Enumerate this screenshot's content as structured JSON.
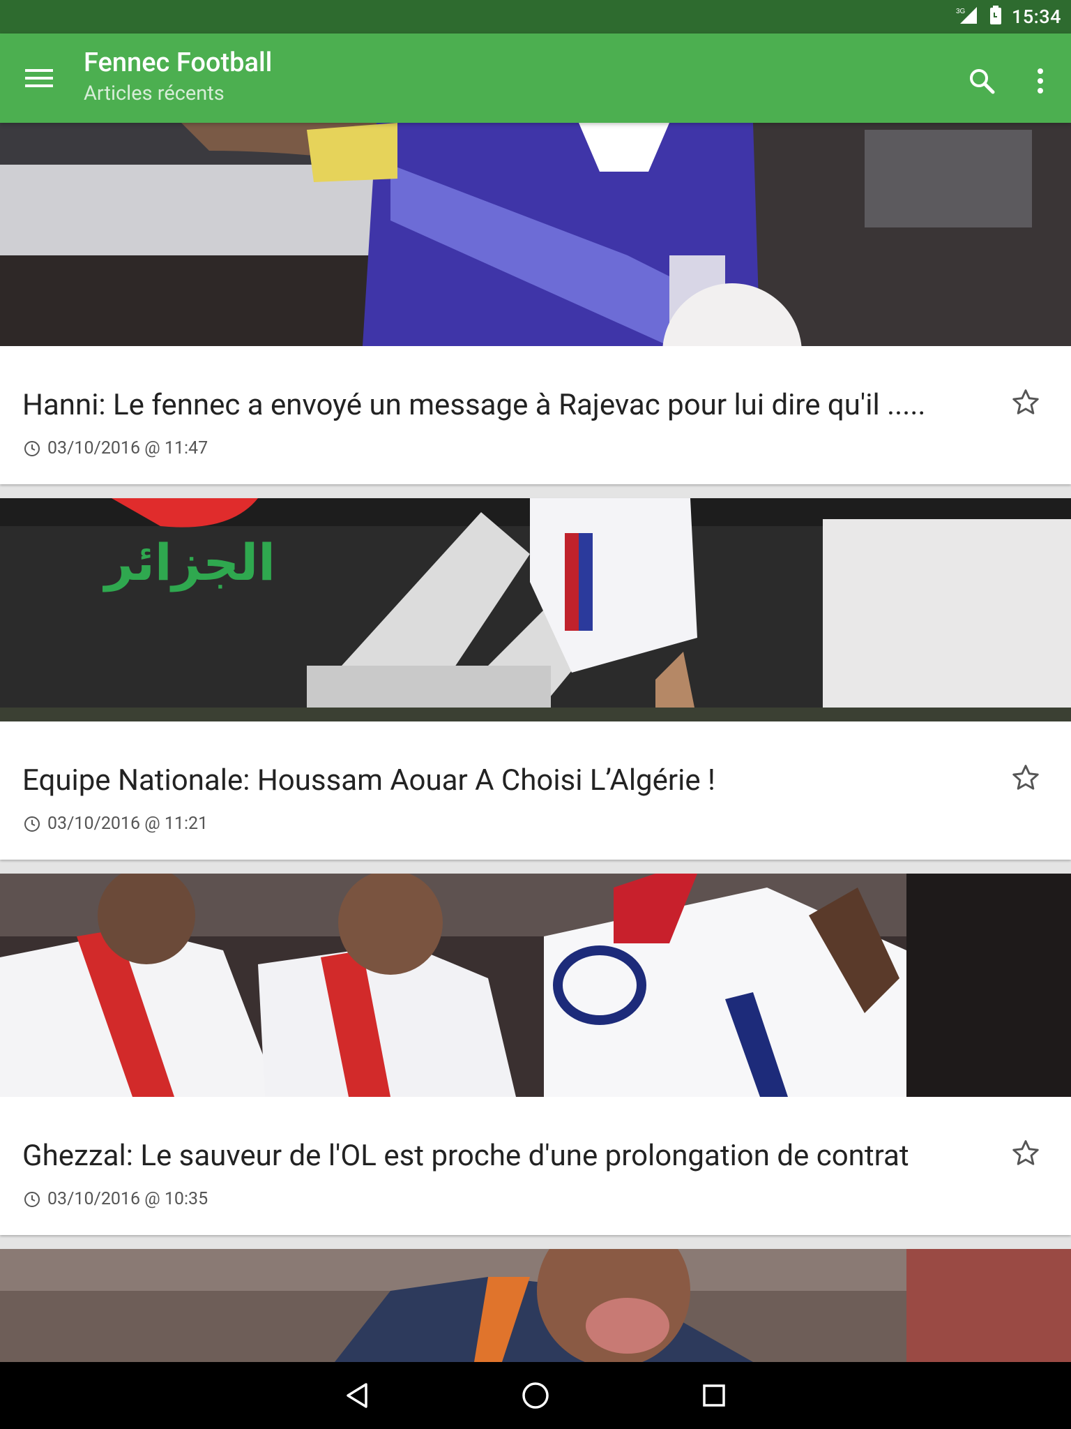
{
  "status_bar": {
    "network": "3G",
    "time": "15:34"
  },
  "app_bar": {
    "title": "Fennec Football",
    "subtitle": "Articles récents",
    "menu_icon": "hamburger-menu-icon",
    "search_icon": "search-icon",
    "overflow_icon": "more-vert-icon"
  },
  "articles": [
    {
      "title": "Hanni: Le fennec a envoyé un message à Rajevac pour lui dire qu'il .....",
      "date": "03/10/2016 @ 11:47",
      "favorited": false
    },
    {
      "title": "Equipe Nationale: Houssam Aouar A Choisi L’Algérie !",
      "date": "03/10/2016 @ 11:21",
      "favorited": false,
      "image_text": "الجزائر"
    },
    {
      "title": "Ghezzal: Le sauveur de l'OL est proche d'une prolongation de contrat",
      "date": "03/10/2016 @ 10:35",
      "favorited": false
    }
  ],
  "nav_bar": {
    "back_icon": "back-triangle-icon",
    "home_icon": "home-circle-icon",
    "recents_icon": "recents-square-icon"
  },
  "colors": {
    "primary": "#4caf50",
    "primary_dark": "#2e6b2f"
  }
}
